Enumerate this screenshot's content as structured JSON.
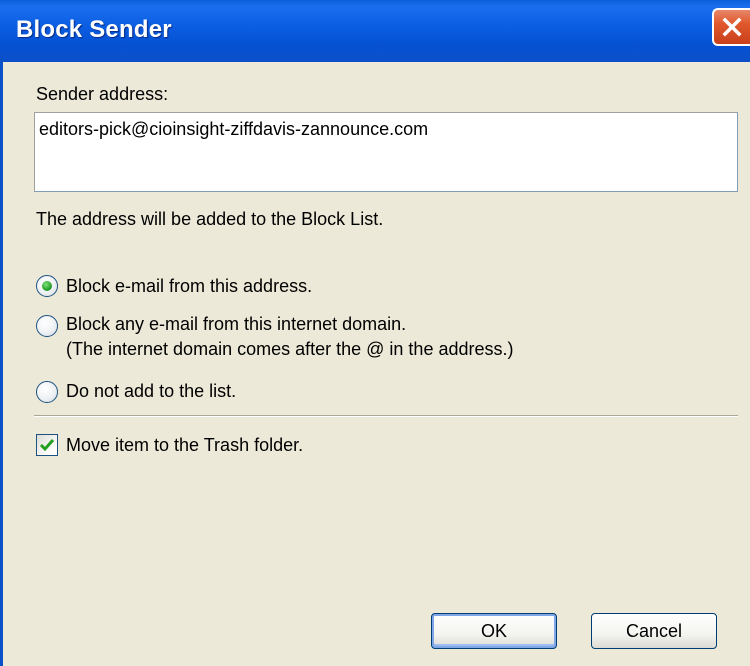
{
  "window": {
    "title": "Block Sender",
    "close_icon": "close-icon"
  },
  "sender": {
    "label": "Sender address:",
    "value": "editors-pick@cioinsight-ziffdavis-zannounce.com"
  },
  "info_text": "The address will be added to the Block List.",
  "options": [
    {
      "label": "Block e-mail from this address.",
      "selected": true
    },
    {
      "label": "Block any e-mail from this internet domain.",
      "sublabel": "(The internet domain comes after the @ in the address.)",
      "selected": false
    },
    {
      "label": "Do not add to the list.",
      "selected": false
    }
  ],
  "move_to_trash": {
    "label": "Move item to the Trash folder.",
    "checked": true
  },
  "buttons": {
    "ok": "OK",
    "cancel": "Cancel"
  },
  "colors": {
    "titlebar": "#0552d4",
    "close": "#e0582c",
    "radio_selected": "#27a12a",
    "checkmark": "#21a121"
  }
}
